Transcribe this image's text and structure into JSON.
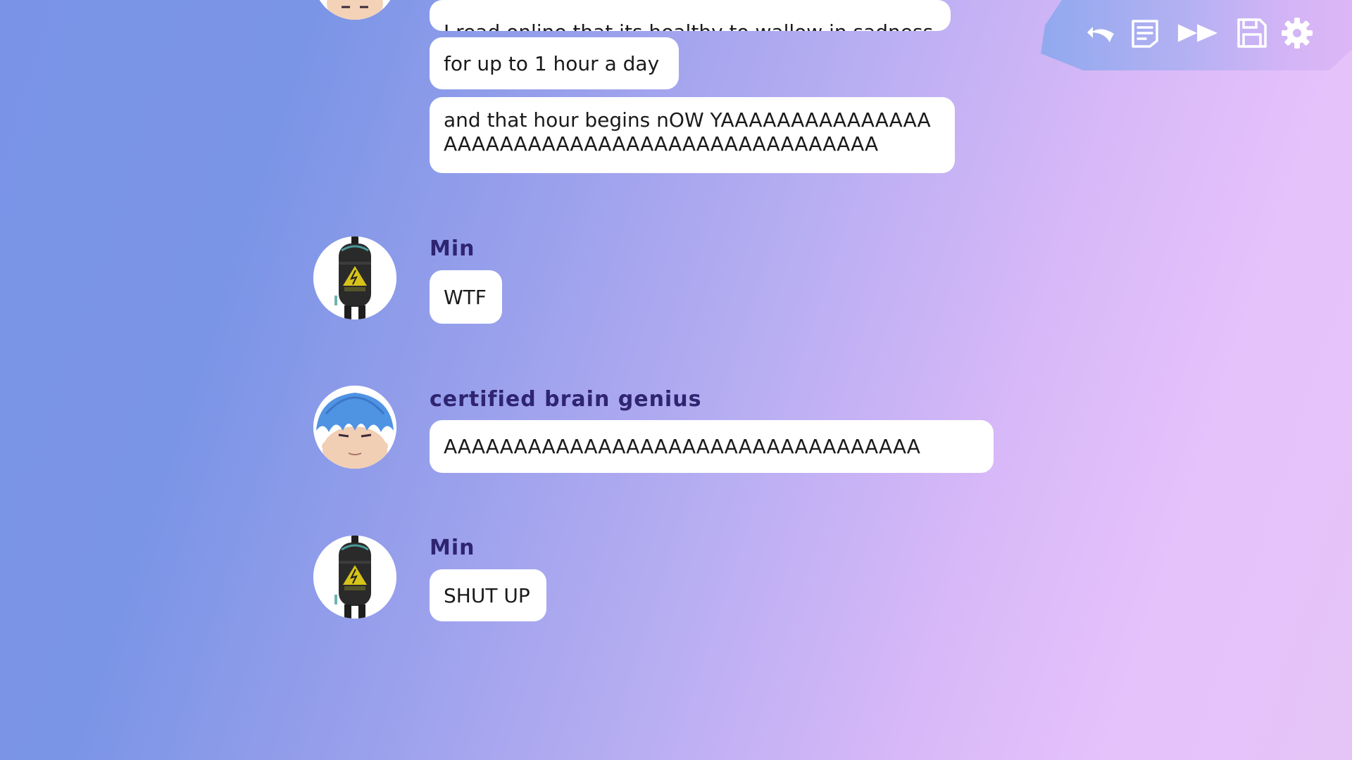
{
  "quick_menu": {
    "buttons": [
      {
        "name": "back",
        "icon": "undo-arrow-icon"
      },
      {
        "name": "history",
        "icon": "history-log-icon"
      },
      {
        "name": "skip",
        "icon": "fast-forward-icon"
      },
      {
        "name": "save",
        "icon": "save-disk-icon"
      },
      {
        "name": "settings",
        "icon": "gear-icon"
      }
    ],
    "icon_color": "#ffffff"
  },
  "chat": {
    "previous_messages": [
      "I read online that its healthy to wallow in sadness",
      "for up to 1 hour a day",
      "and that hour begins nOW YAAAAAAAAAAAAAAAAAAAAAAAAAAAAAAAAAAAAAAAAAAAAAA"
    ],
    "groups": [
      {
        "sender": "Min",
        "avatar": "backpack-character-avatar",
        "messages": [
          "WTF"
        ]
      },
      {
        "sender": "certified brain genius",
        "avatar": "blue-haired-character-avatar",
        "messages": [
          "AAAAAAAAAAAAAAAAAAAAAAAAAAAAAAAAAA"
        ]
      },
      {
        "sender": "Min",
        "avatar": "backpack-character-avatar",
        "messages": [
          "SHUT UP"
        ]
      }
    ]
  },
  "colors": {
    "name_text": "#2f2470",
    "bubble_bg": "#ffffff",
    "bg_left": "#7a93e6",
    "bg_right": "#e6c2fb"
  }
}
